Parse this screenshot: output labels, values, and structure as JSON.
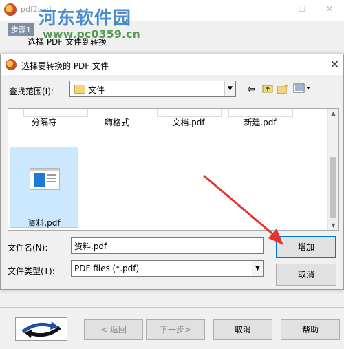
{
  "app": {
    "title": "pdf2cad",
    "step_badge": "步骤1",
    "step_text": "选择 PDF 文件到转换"
  },
  "watermark": {
    "text": "河东软件园",
    "url": "www.pc0359.cn"
  },
  "dialog": {
    "title": "选择要转换的 PDF 文件",
    "close": "✕",
    "look_in_label": "查找范围(I):",
    "look_in_value": "文件",
    "files": [
      "分隔符",
      "嗨格式",
      "文档.pdf",
      "新建.pdf",
      "资料.pdf"
    ],
    "selected_file": "资料.pdf",
    "filename_label": "文件名(N):",
    "filename_value": "资料.pdf",
    "filetype_label": "文件类型(T):",
    "filetype_value": "PDF files (*.pdf)",
    "open_button": "增加",
    "cancel_button": "取消"
  },
  "wizard": {
    "back": "< 返回",
    "next": "下一步>",
    "cancel": "取消",
    "help": "帮助"
  },
  "colors": {
    "arrow": "#e8332a",
    "selection": "#cce8ff",
    "accent": "#0078d7"
  }
}
